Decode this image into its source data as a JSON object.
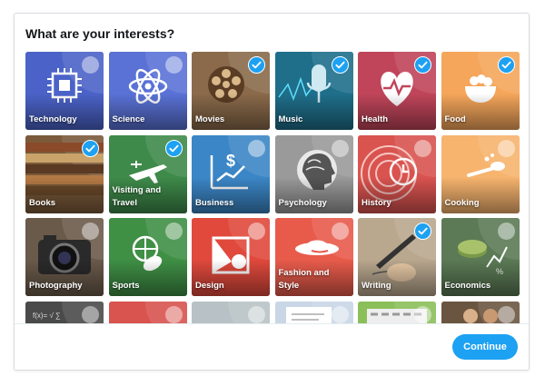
{
  "dialog": {
    "title": "What are your interests?"
  },
  "interests": [
    {
      "id": "technology",
      "label": "Technology",
      "selected": false,
      "color": "#4b63c8",
      "icon": "chip-icon"
    },
    {
      "id": "science",
      "label": "Science",
      "selected": false,
      "color": "#5a72d6",
      "icon": "atom-icon"
    },
    {
      "id": "movies",
      "label": "Movies",
      "selected": true,
      "color": "#8a6a4a",
      "icon": "film-reel-icon"
    },
    {
      "id": "music",
      "label": "Music",
      "selected": true,
      "color": "#1f6f8b",
      "icon": "microphone-icon"
    },
    {
      "id": "health",
      "label": "Health",
      "selected": true,
      "color": "#c0455a",
      "icon": "heart-pulse-icon"
    },
    {
      "id": "food",
      "label": "Food",
      "selected": true,
      "color": "#f5a65b",
      "icon": "bowl-icon"
    },
    {
      "id": "books",
      "label": "Books",
      "selected": true,
      "color": "#7a5a3a",
      "icon": "books-icon"
    },
    {
      "id": "visiting-and-travel",
      "label": "Visiting and Travel",
      "selected": true,
      "color": "#3e8a4a",
      "icon": "airplane-icon"
    },
    {
      "id": "business",
      "label": "Business",
      "selected": false,
      "color": "#3b86c6",
      "icon": "chart-dollar-icon"
    },
    {
      "id": "psychology",
      "label": "Psychology",
      "selected": false,
      "color": "#9a9a9a",
      "icon": "head-profile-icon"
    },
    {
      "id": "history",
      "label": "History",
      "selected": false,
      "color": "#d9534f",
      "icon": "clock-history-icon"
    },
    {
      "id": "cooking",
      "label": "Cooking",
      "selected": false,
      "color": "#f6b46e",
      "icon": "spoon-icon"
    },
    {
      "id": "photography",
      "label": "Photography",
      "selected": false,
      "color": "#6a5a4a",
      "icon": "camera-icon"
    },
    {
      "id": "sports",
      "label": "Sports",
      "selected": false,
      "color": "#3f8f45",
      "icon": "ball-icon"
    },
    {
      "id": "design",
      "label": "Design",
      "selected": false,
      "color": "#e0493c",
      "icon": "shapes-icon"
    },
    {
      "id": "fashion-and-style",
      "label": "Fashion and Style",
      "selected": false,
      "color": "#e85b4b",
      "icon": "hat-icon"
    },
    {
      "id": "writing",
      "label": "Writing",
      "selected": true,
      "color": "#b9a78e",
      "icon": "pen-icon"
    },
    {
      "id": "economics",
      "label": "Economics",
      "selected": false,
      "color": "#5b7a55",
      "icon": "coins-icon"
    },
    {
      "id": "more-1",
      "label": "",
      "selected": false,
      "color": "#4a4a4a",
      "icon": "chalkboard-icon"
    },
    {
      "id": "more-2",
      "label": "",
      "selected": false,
      "color": "#d9534f",
      "icon": ""
    },
    {
      "id": "more-3",
      "label": "",
      "selected": false,
      "color": "#b8c2c6",
      "icon": ""
    },
    {
      "id": "more-4",
      "label": "",
      "selected": false,
      "color": "#c9d6e6",
      "icon": "document-icon"
    },
    {
      "id": "more-5",
      "label": "",
      "selected": false,
      "color": "#8bbf5a",
      "icon": "keyboard-icon"
    },
    {
      "id": "more-6",
      "label": "",
      "selected": false,
      "color": "#6a5540",
      "icon": "people-icon"
    }
  ],
  "footer": {
    "continue_label": "Continue"
  }
}
